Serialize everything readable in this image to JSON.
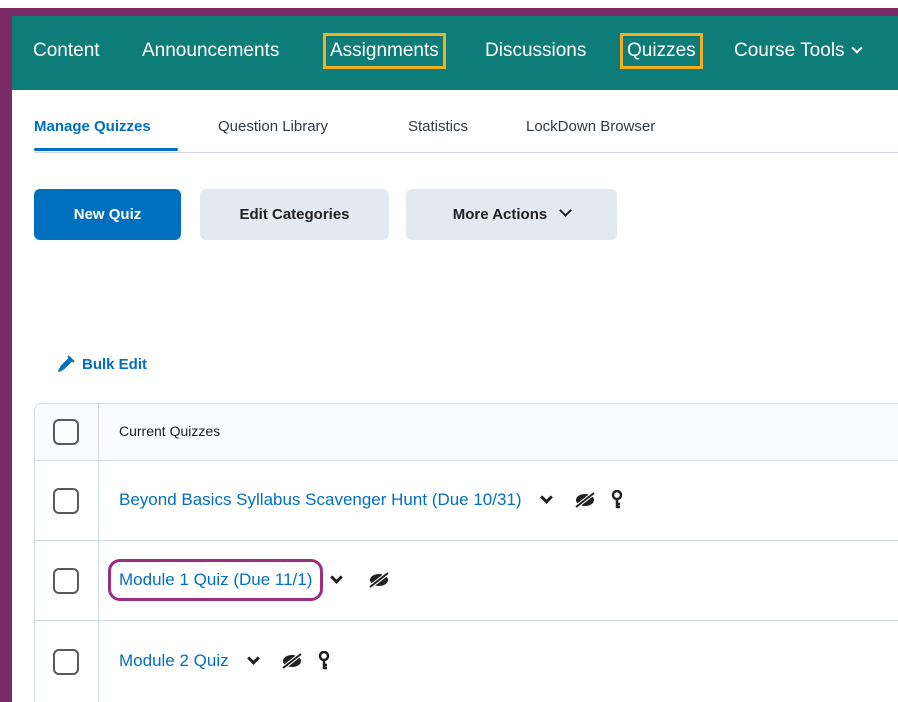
{
  "nav": {
    "items": [
      {
        "label": "Content"
      },
      {
        "label": "Announcements"
      },
      {
        "label": "Assignments"
      },
      {
        "label": "Discussions"
      },
      {
        "label": "Quizzes"
      },
      {
        "label": "Course Tools"
      }
    ],
    "highlighted": [
      "Assignments",
      "Quizzes"
    ],
    "background_color": "#0e7d7a",
    "highlight_color": "#f2b01e"
  },
  "subnav": {
    "tabs": [
      {
        "label": "Manage Quizzes",
        "active": true
      },
      {
        "label": "Question Library"
      },
      {
        "label": "Statistics"
      },
      {
        "label": "LockDown Browser"
      }
    ]
  },
  "actions": {
    "new_quiz": "New Quiz",
    "edit_categories": "Edit Categories",
    "more_actions": "More Actions"
  },
  "bulk_edit": {
    "label": "Bulk Edit",
    "icon": "pencil-icon"
  },
  "table": {
    "header": "Current Quizzes",
    "rows": [
      {
        "title": "Beyond Basics Syllabus Scavenger Hunt (Due 10/31)",
        "icons": [
          "hidden-eye-icon",
          "restricted-key-icon"
        ]
      },
      {
        "title": "Module 1 Quiz (Due 11/1)",
        "icons": [
          "hidden-eye-icon"
        ],
        "highlighted": true
      },
      {
        "title": "Module 2 Quiz",
        "icons": [
          "hidden-eye-icon",
          "restricted-key-icon"
        ]
      }
    ]
  },
  "colors": {
    "primary": "#006fbf",
    "frame": "#7b2a67",
    "row_highlight": "#9a2f7d"
  }
}
